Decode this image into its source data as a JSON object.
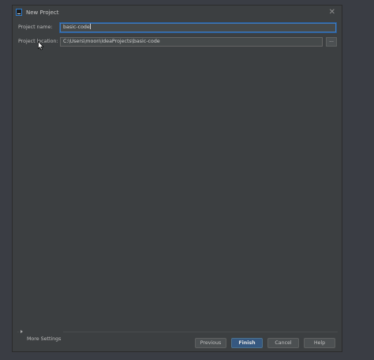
{
  "window": {
    "title": "New Project",
    "close_glyph": "✕"
  },
  "form": {
    "project_name_label": "Project name:",
    "project_name_value": "basic-code",
    "project_location_label": "Project location:",
    "project_location_value": "C:\\Users\\moon\\IdeaProjects\\basic-code",
    "browse_label": "..."
  },
  "more_settings": {
    "label": "More Settings"
  },
  "buttons": {
    "previous": "Previous",
    "finish": "Finish",
    "cancel": "Cancel",
    "help": "Help"
  },
  "icons": {
    "app": "intellij-idea-icon",
    "close": "close-icon",
    "expand": "triangle-right-icon",
    "cursor": "mouse-pointer-icon"
  },
  "colors": {
    "dialog_bg": "#3c3f41",
    "focus_border": "#3d7bc5",
    "primary_button": "#365880"
  }
}
